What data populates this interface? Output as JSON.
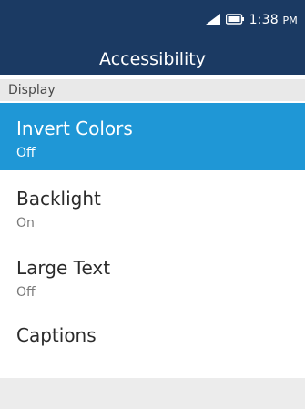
{
  "status_bar": {
    "time": "1:38",
    "ampm": "PM",
    "icons": [
      "signal-icon",
      "battery-icon"
    ]
  },
  "header": {
    "title": "Accessibility"
  },
  "section": {
    "label": "Display"
  },
  "items": [
    {
      "label": "Invert Colors",
      "value": "Off",
      "selected": true
    },
    {
      "label": "Backlight",
      "value": "On",
      "selected": false
    },
    {
      "label": "Large Text",
      "value": "Off",
      "selected": false
    },
    {
      "label": "Captions",
      "value": "",
      "selected": false
    }
  ],
  "colors": {
    "header_bg": "#1b3a63",
    "selected_bg": "#1f97d6",
    "section_bg": "#e9e9e9"
  }
}
